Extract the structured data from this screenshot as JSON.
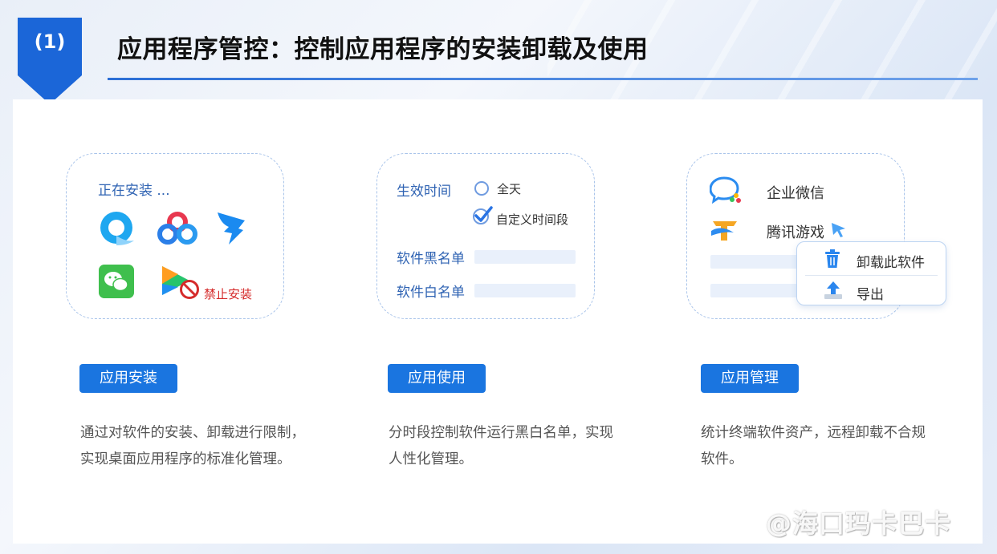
{
  "header": {
    "badge_number": "(1)",
    "title": "应用程序管控：控制应用程序的安装卸载及使用"
  },
  "cards": {
    "install": {
      "status_text": "正在安装 ...",
      "forbidden_label": "禁止安装",
      "icons": [
        "browser-app-icon",
        "cloud-drive-app-icon",
        "dingtalk-app-icon",
        "wechat-app-icon",
        "video-app-icon",
        "no-entry-icon"
      ]
    },
    "usage": {
      "effective_time_label": "生效时间",
      "option_all_day": "全天",
      "option_custom": "自定义时间段",
      "blacklist_label": "软件黑名单",
      "whitelist_label": "软件白名单"
    },
    "manage": {
      "apps": [
        "企业微信",
        "腾讯游戏"
      ],
      "context_menu": {
        "uninstall": "卸载此软件",
        "export": "导出"
      }
    }
  },
  "buttons": {
    "install": "应用安装",
    "usage": "应用使用",
    "manage": "应用管理"
  },
  "descriptions": {
    "install": [
      "通过对软件的安装、卸载进行限制，",
      "实现桌面应用程序的标准化管理。"
    ],
    "usage": [
      "分时段控制软件运行黑白名单，实现",
      "人性化管理。"
    ],
    "manage": [
      "统计终端软件资产，远程卸载不合规",
      "软件。"
    ]
  },
  "watermark": "@海口玛卡巴卡",
  "colors": {
    "accent": "#1a75e0",
    "badge": "#1b66d8",
    "forbidden": "#d52b2b",
    "label_blue": "#2f63b3"
  }
}
